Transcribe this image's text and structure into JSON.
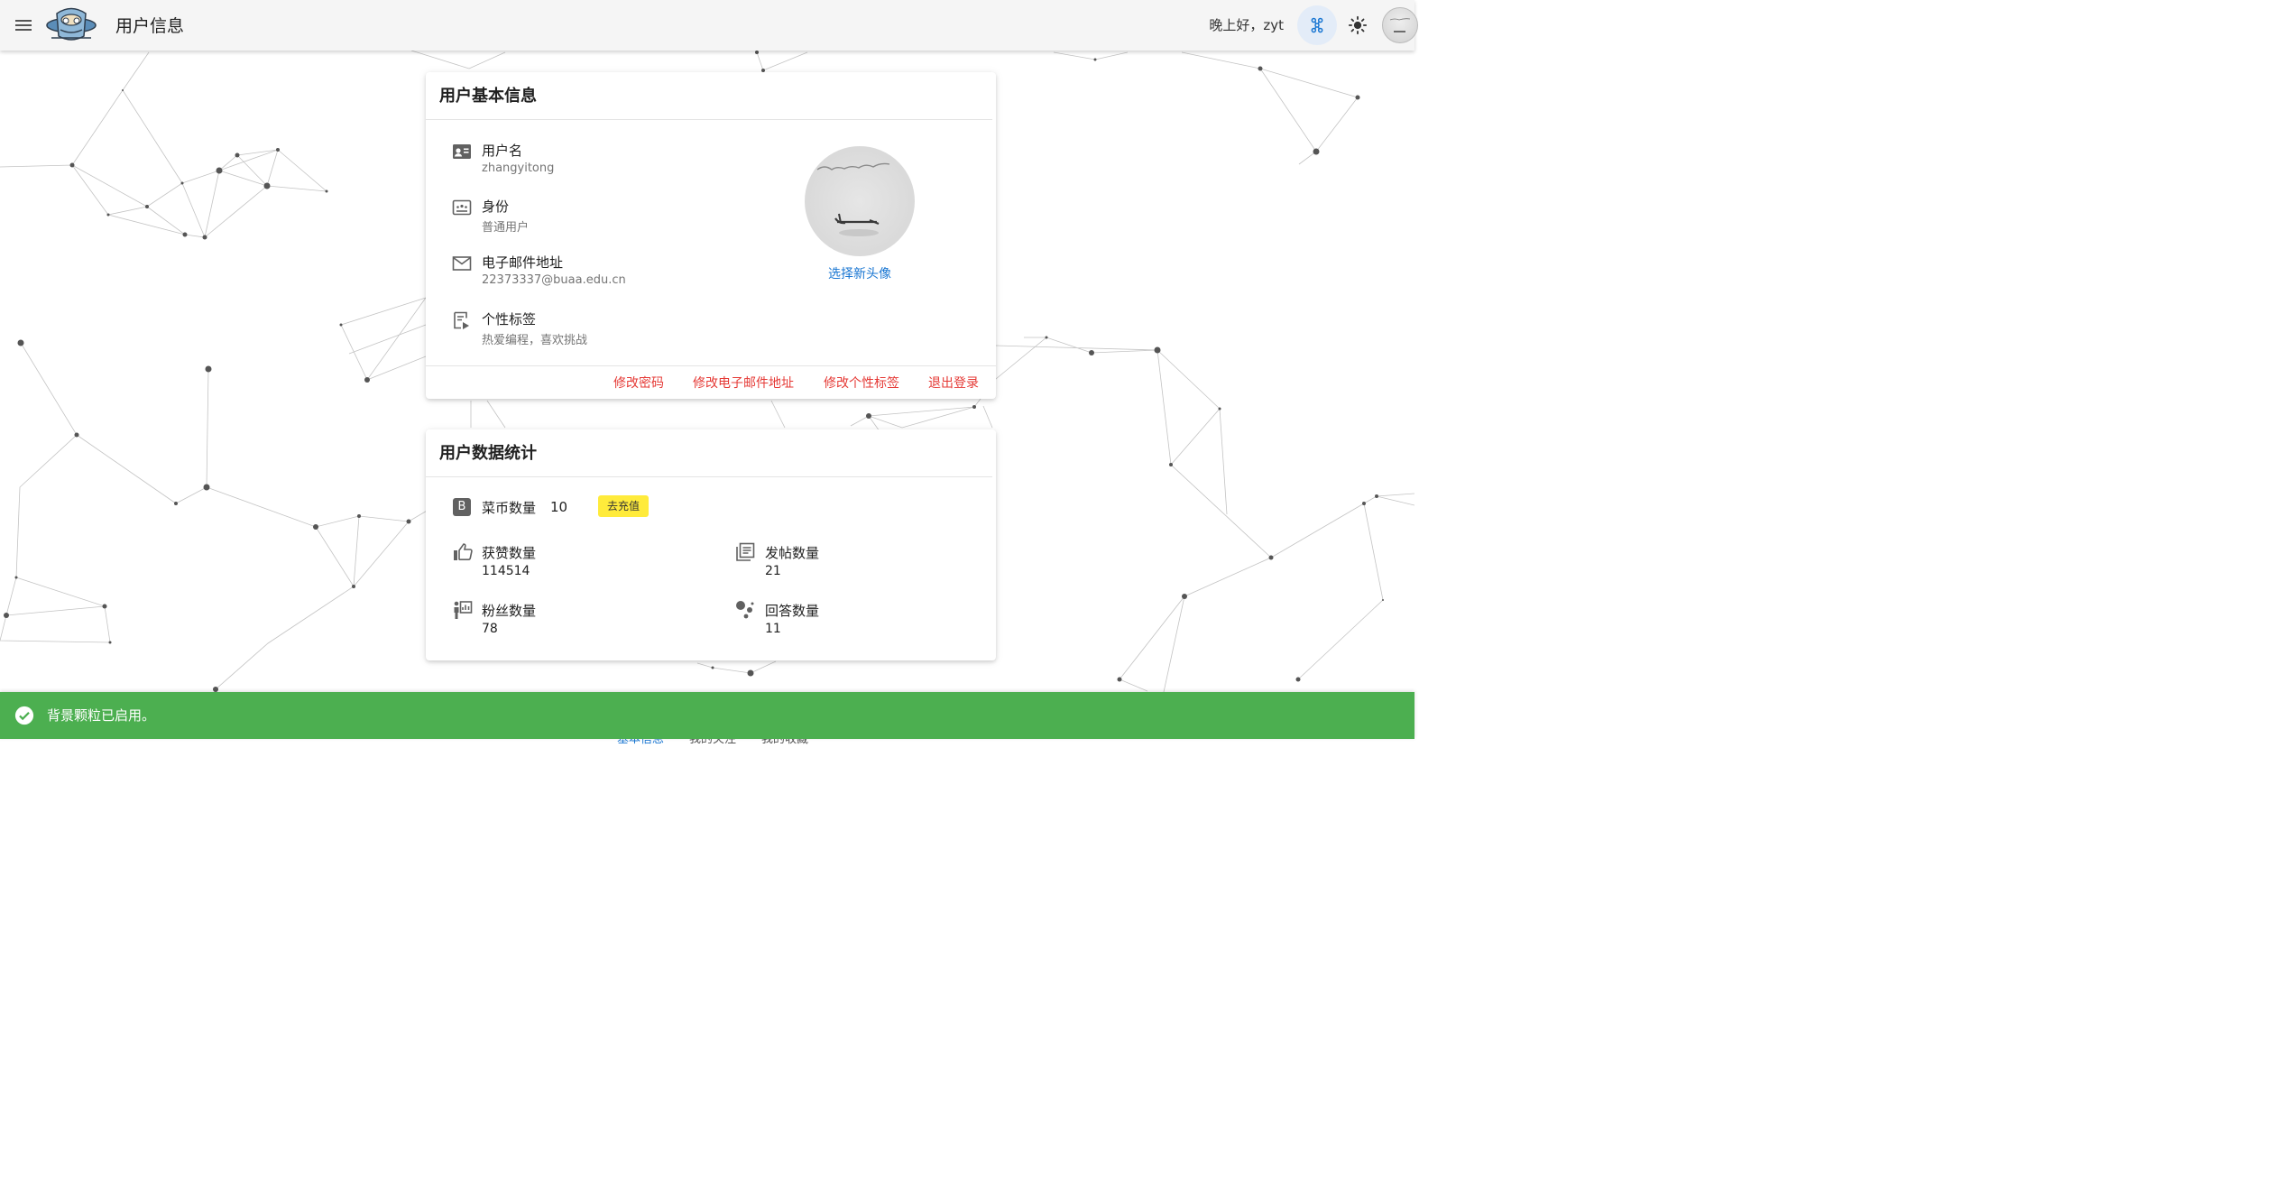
{
  "header": {
    "title": "用户信息",
    "greeting": "晚上好，zyt"
  },
  "profile_card": {
    "title": "用户基本信息",
    "fields": [
      {
        "label": "用户名",
        "value": "zhangyitong",
        "icon": "account-box-icon"
      },
      {
        "label": "身份",
        "value": "普通用户",
        "icon": "identity-card-icon"
      },
      {
        "label": "电子邮件地址",
        "value": "22373337@buaa.edu.cn",
        "icon": "email-icon"
      },
      {
        "label": "个性标签",
        "value": "热爱编程，喜欢挑战",
        "icon": "signature-icon"
      }
    ],
    "choose_avatar": "选择新头像",
    "actions": [
      "修改密码",
      "修改电子邮件地址",
      "修改个性标签",
      "退出登录"
    ],
    "action_color": "#e53935"
  },
  "stats_card": {
    "title": "用户数据统计",
    "coins": {
      "label": "菜币数量",
      "value": "10",
      "badge": "B",
      "recharge": "去充值"
    },
    "likes": {
      "label": "获赞数量",
      "value": "114514",
      "icon": "thumb-up-icon"
    },
    "posts": {
      "label": "发帖数量",
      "value": "21",
      "icon": "posts-icon"
    },
    "fans": {
      "label": "粉丝数量",
      "value": "78",
      "icon": "fans-icon"
    },
    "answers": {
      "label": "回答数量",
      "value": "11",
      "icon": "answers-icon"
    }
  },
  "bottom_tabs": [
    "基本信息",
    "我的关注",
    "我的收藏"
  ],
  "snackbar": {
    "text": "背景颗粒已启用。",
    "color": "#4caf50"
  },
  "colors": {
    "accent": "#1976d2",
    "danger": "#e53935",
    "chip": "#ffeb3b"
  }
}
